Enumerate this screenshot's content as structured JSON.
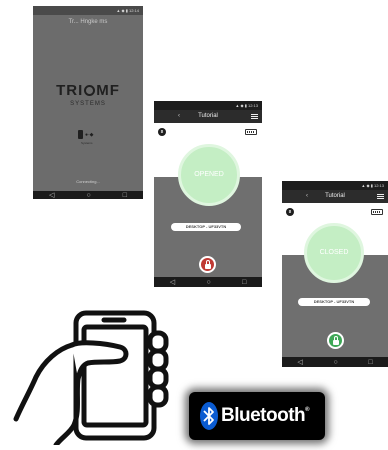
{
  "splash": {
    "title": "Tr... Hngke ms",
    "logo_left": "TRI",
    "logo_right": "MF",
    "subtitle": "SYSTEMS",
    "small_caption": "Systems",
    "status": "Connecting..."
  },
  "opened_screen": {
    "header_title": "Tutorial",
    "state_label": "OPENED",
    "device_name": "DESKTOP - UF33VTN",
    "lock_state": "unlocked",
    "lock_color": "#c03a34"
  },
  "closed_screen": {
    "header_title": "Tutorial",
    "state_label": "CLOSED",
    "device_name": "DESKTOP - UF33VTN",
    "lock_state": "locked",
    "lock_color": "#3ea857"
  },
  "bluetooth": {
    "label": "Bluetooth",
    "mark": "®"
  },
  "nav": {
    "back": "◁",
    "home": "○",
    "recent": "□"
  },
  "icons": [
    "menu-icon",
    "bluetooth-icon",
    "battery-icon",
    "lock-icon",
    "hand-holding-phone-icon"
  ]
}
